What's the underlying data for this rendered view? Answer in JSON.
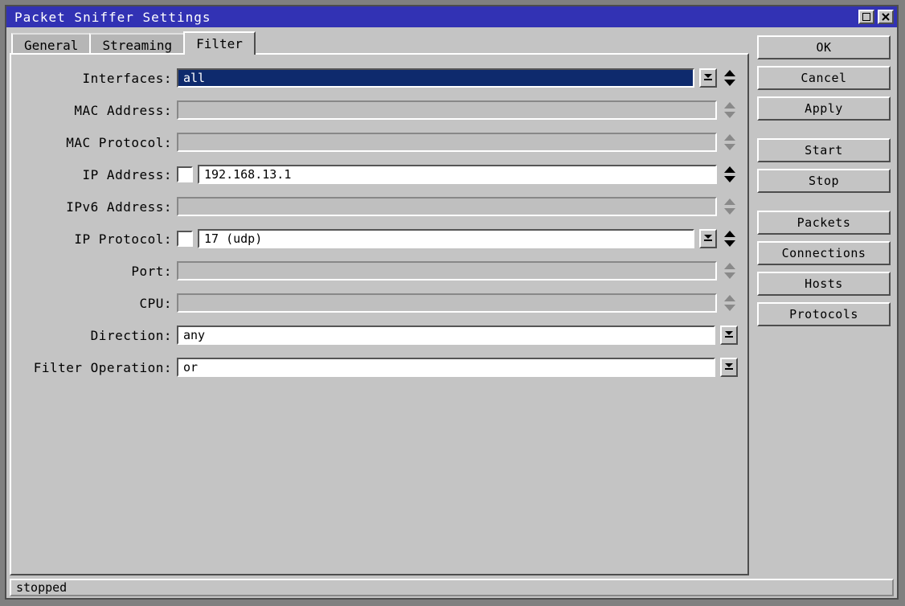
{
  "window": {
    "title": "Packet Sniffer Settings"
  },
  "tabs": {
    "items": [
      {
        "label": "General"
      },
      {
        "label": "Streaming"
      },
      {
        "label": "Filter"
      }
    ],
    "active_index": 2
  },
  "form": {
    "interfaces": {
      "label": "Interfaces:",
      "value": "all",
      "has_checkbox": false,
      "has_dropdown": true,
      "enabled": true,
      "spinner_enabled": true,
      "highlighted": true
    },
    "mac_address": {
      "label": "MAC Address:",
      "value": "",
      "has_checkbox": false,
      "has_dropdown": false,
      "enabled": false,
      "spinner_enabled": false,
      "highlighted": false
    },
    "mac_protocol": {
      "label": "MAC Protocol:",
      "value": "",
      "has_checkbox": false,
      "has_dropdown": false,
      "enabled": false,
      "spinner_enabled": false,
      "highlighted": false
    },
    "ip_address": {
      "label": "IP Address:",
      "value": "192.168.13.1",
      "has_checkbox": true,
      "has_dropdown": false,
      "enabled": true,
      "spinner_enabled": true,
      "highlighted": false
    },
    "ipv6_address": {
      "label": "IPv6 Address:",
      "value": "",
      "has_checkbox": false,
      "has_dropdown": false,
      "enabled": false,
      "spinner_enabled": false,
      "highlighted": false
    },
    "ip_protocol": {
      "label": "IP Protocol:",
      "value": "17 (udp)",
      "has_checkbox": true,
      "has_dropdown": true,
      "enabled": true,
      "spinner_enabled": true,
      "highlighted": false
    },
    "port": {
      "label": "Port:",
      "value": "",
      "has_checkbox": false,
      "has_dropdown": false,
      "enabled": false,
      "spinner_enabled": false,
      "highlighted": false
    },
    "cpu": {
      "label": "CPU:",
      "value": "",
      "has_checkbox": false,
      "has_dropdown": false,
      "enabled": false,
      "spinner_enabled": false,
      "highlighted": false
    },
    "direction": {
      "label": "Direction:",
      "value": "any",
      "has_checkbox": false,
      "has_dropdown": true,
      "enabled": true,
      "spinner_enabled": false,
      "highlighted": false
    },
    "filter_operation": {
      "label": "Filter Operation:",
      "value": "or",
      "has_checkbox": false,
      "has_dropdown": true,
      "enabled": true,
      "spinner_enabled": false,
      "highlighted": false
    }
  },
  "buttons": {
    "ok": "OK",
    "cancel": "Cancel",
    "apply": "Apply",
    "start": "Start",
    "stop": "Stop",
    "packets": "Packets",
    "connections": "Connections",
    "hosts": "Hosts",
    "protocols": "Protocols"
  },
  "status": "stopped"
}
